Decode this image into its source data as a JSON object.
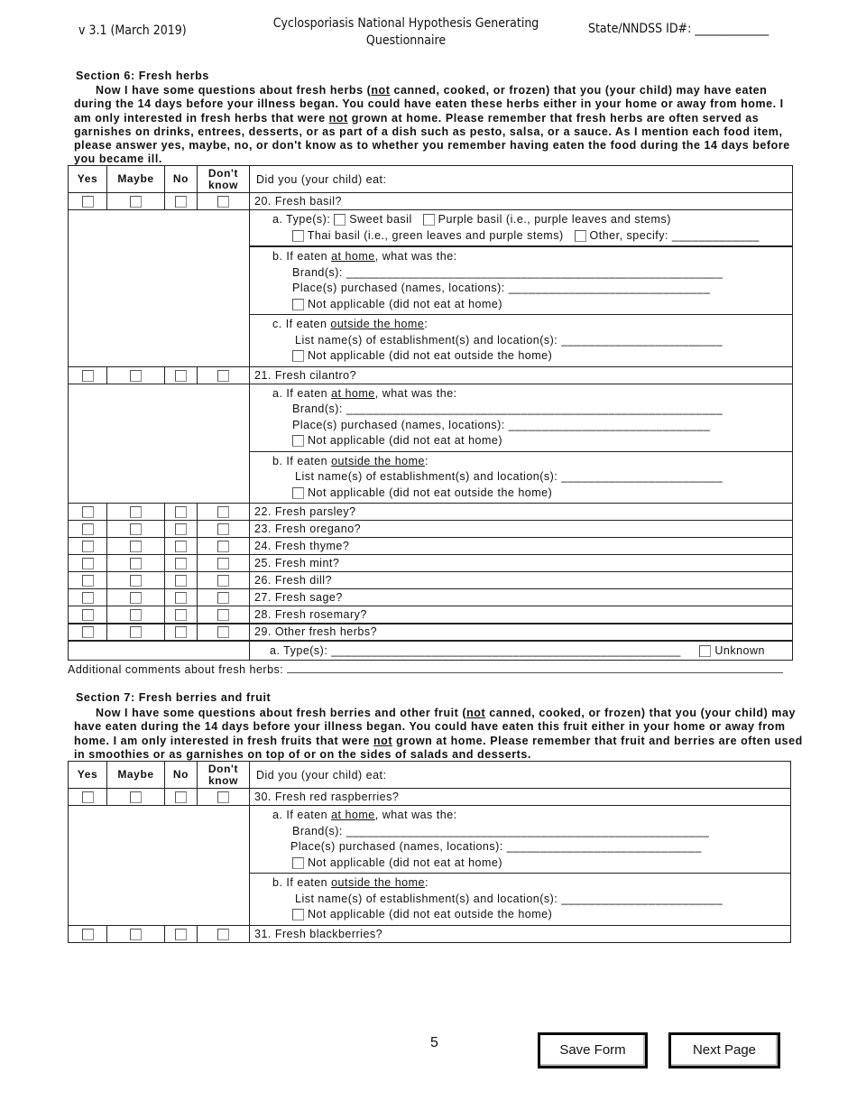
{
  "header": {
    "version": "v 3.1 (March 2019)",
    "title_line1": "Cyclosporiasis National Hypothesis Generating",
    "title_line2": "Questionnaire",
    "state_id_label": "State/NNDSS ID#: _____________"
  },
  "answer_columns": [
    "Yes",
    "Maybe",
    "No"
  ],
  "dont_know_line1": "Don't",
  "dont_know_line2": "know",
  "question_header": "Did you (your child) eat:",
  "section6": {
    "title": "Section 6: Fresh herbs",
    "intro_p1": "Now I have some questions about fresh herbs (",
    "intro_not1": "not",
    "intro_p2": " canned, cooked, or frozen) that you (your child) may have eaten during the 14 days before your illness began. You could have eaten these herbs either in your home or away from home. I am only interested in fresh herbs that were ",
    "intro_not2": "not",
    "intro_p3": " grown at home. Please remember that fresh herbs are often served as garnishes on drinks, entrees, desserts, or as part of a dish such as pesto, salsa, or a sauce. As I mention each food item, please answer yes, maybe, no, or don't know as to whether you remember having eaten the food during the 14 days before you became ill.",
    "q20": {
      "label": "20.  Fresh basil?",
      "type_label": "a. Type(s):",
      "types": [
        "Sweet basil",
        "Purple basil (i.e., purple leaves and stems)",
        "Thai basil (i.e., green leaves and purple stems)",
        "Other, specify: _____________"
      ],
      "home_prefix": "b. If eaten ",
      "home_u": "at home",
      "home_suffix": ", what was the:",
      "brand": "Brand(s): ________________________________________________________",
      "place": "Place(s) purchased (names, locations): ______________________________",
      "na_home": "Not applicable (did not eat at home)",
      "out_prefix": "c. If eaten ",
      "out_u": "outside the home",
      "out_suffix": ":",
      "establishments": "List name(s) of establishment(s) and location(s): ________________________",
      "na_out": "Not applicable (did not eat outside the home)"
    },
    "q21": {
      "label": "21.  Fresh cilantro?",
      "home_prefix": "a. If eaten ",
      "home_u": "at home",
      "home_suffix": ", what was the:",
      "brand": "Brand(s): ________________________________________________________",
      "place": "Place(s) purchased (names, locations): ______________________________",
      "na_home": "Not applicable (did not eat at home)",
      "out_prefix": "b. If eaten ",
      "out_u": "outside the home",
      "out_suffix": ":",
      "establishments": "List name(s) of establishment(s) and location(s): ________________________",
      "na_out": "Not applicable (did not eat outside the home)"
    },
    "simple_questions": [
      "22.  Fresh parsley?",
      "23.  Fresh oregano?",
      "24.  Fresh thyme?",
      "25.  Fresh mint?",
      "26.  Fresh dill?",
      "27.  Fresh sage?",
      "28.  Fresh rosemary?",
      "29.  Other fresh herbs?"
    ],
    "q29_type": "a. Type(s): ____________________________________________________",
    "q29_unknown": "Unknown",
    "comments_label": "Additional comments about fresh herbs:"
  },
  "section7": {
    "title": "Section 7: Fresh berries and fruit",
    "intro_p1": "Now I have some questions about fresh berries and other fruit (",
    "intro_not1": "not",
    "intro_p2": " canned, cooked, or frozen) that you (your child) may have eaten during the 14 days before your illness began. You could have eaten this fruit either in your home or away from home. I am only interested in fresh fruits that were ",
    "intro_not2": "not",
    "intro_p3": " grown at home. Please remember that fruit and berries are often used in smoothies or as garnishes on top of or on the sides of salads and desserts.",
    "q30": {
      "label": "30.  Fresh red raspberries?",
      "home_prefix": "a. If eaten ",
      "home_u": "at home",
      "home_suffix": ", what was the:",
      "brand": "Brand(s): ______________________________________________________",
      "place": "Place(s) purchased (names, locations): _____________________________",
      "na_home": "Not applicable (did not eat at home)",
      "out_prefix": "b. If eaten ",
      "out_u": "outside the home",
      "out_suffix": ":",
      "establishments": "List name(s) of establishment(s) and location(s): ________________________",
      "na_out": "Not applicable (did not eat outside the home)"
    },
    "q31": {
      "label": "31.  Fresh blackberries?"
    }
  },
  "footer": {
    "page_number": "5",
    "save_button": "Save Form",
    "next_button": "Next Page"
  }
}
